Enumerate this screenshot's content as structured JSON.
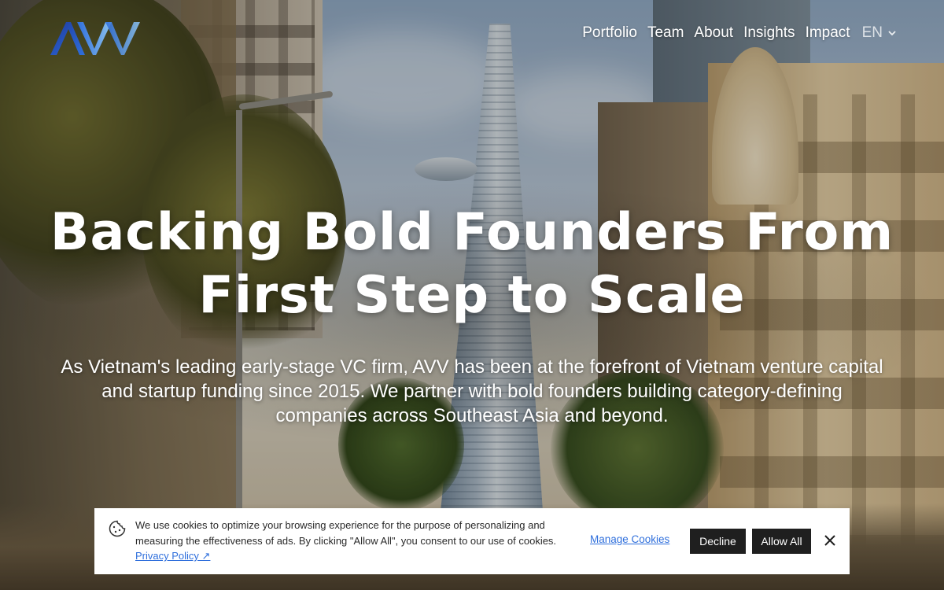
{
  "brand": {
    "logo_text": "AVV",
    "logo_colors": [
      "#1e3a9e",
      "#2f6fdc",
      "#7fb4e8"
    ]
  },
  "nav": {
    "items": [
      {
        "label": "Portfolio"
      },
      {
        "label": "Team"
      },
      {
        "label": "About"
      },
      {
        "label": "Insights"
      },
      {
        "label": "Impact"
      }
    ],
    "language": "EN"
  },
  "hero": {
    "title_line1": "Backing Bold Founders From",
    "title_line2": "First Step to Scale",
    "subtitle": "As Vietnam's leading early-stage VC firm, AVV has been at the forefront of Vietnam venture capital and startup funding since 2015. We partner with bold founders building category-defining companies across Southeast Asia and beyond."
  },
  "cookie_banner": {
    "text": "We use cookies to optimize your browsing experience for the purpose of personalizing and measuring the effectiveness of ads. By clicking \"Allow All\", you consent to our use of cookies.",
    "privacy_link": "Privacy Policy ↗",
    "manage_label": "Manage Cookies",
    "decline_label": "Decline",
    "allow_label": "Allow All"
  },
  "colors": {
    "link": "#2f6fdc",
    "button_dark": "#1f1f1f",
    "banner_bg": "#ffffff"
  }
}
